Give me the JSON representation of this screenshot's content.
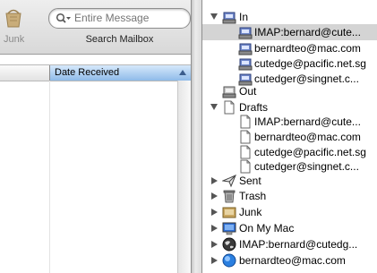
{
  "toolbar": {
    "junk_label": "Junk",
    "search_placeholder": "Entire Message",
    "search_label": "Search Mailbox"
  },
  "message_list": {
    "column_date": "Date Received"
  },
  "mailboxes": {
    "in": {
      "label": "In",
      "accounts": [
        "IMAP:bernard@cute...",
        "bernardteo@mac.com",
        "cutedge@pacific.net.sg",
        "cutedger@singnet.c..."
      ]
    },
    "out": {
      "label": "Out"
    },
    "drafts": {
      "label": "Drafts",
      "accounts": [
        "IMAP:bernard@cute...",
        "bernardteo@mac.com",
        "cutedge@pacific.net.sg",
        "cutedger@singnet.c..."
      ]
    },
    "sent": {
      "label": "Sent"
    },
    "trash": {
      "label": "Trash"
    },
    "junk": {
      "label": "Junk"
    },
    "on_my_mac": {
      "label": "On My Mac"
    },
    "imap_account": {
      "label": "IMAP:bernard@cutedg..."
    },
    "mac_account": {
      "label": "bernardteo@mac.com"
    }
  },
  "icons": {
    "inbox": "inbox-tray-icon",
    "outbox": "outbox-tray-icon",
    "draft": "document-icon",
    "sent": "paper-plane-icon",
    "trash": "trash-can-icon",
    "junk": "junk-mailbox-icon",
    "on_my_mac": "computer-icon",
    "imap": "globe-icon",
    "mac": "dotmac-icon"
  },
  "colors": {
    "selected_row": "#d4d4d4",
    "sort_column": "#8fbbe9"
  }
}
